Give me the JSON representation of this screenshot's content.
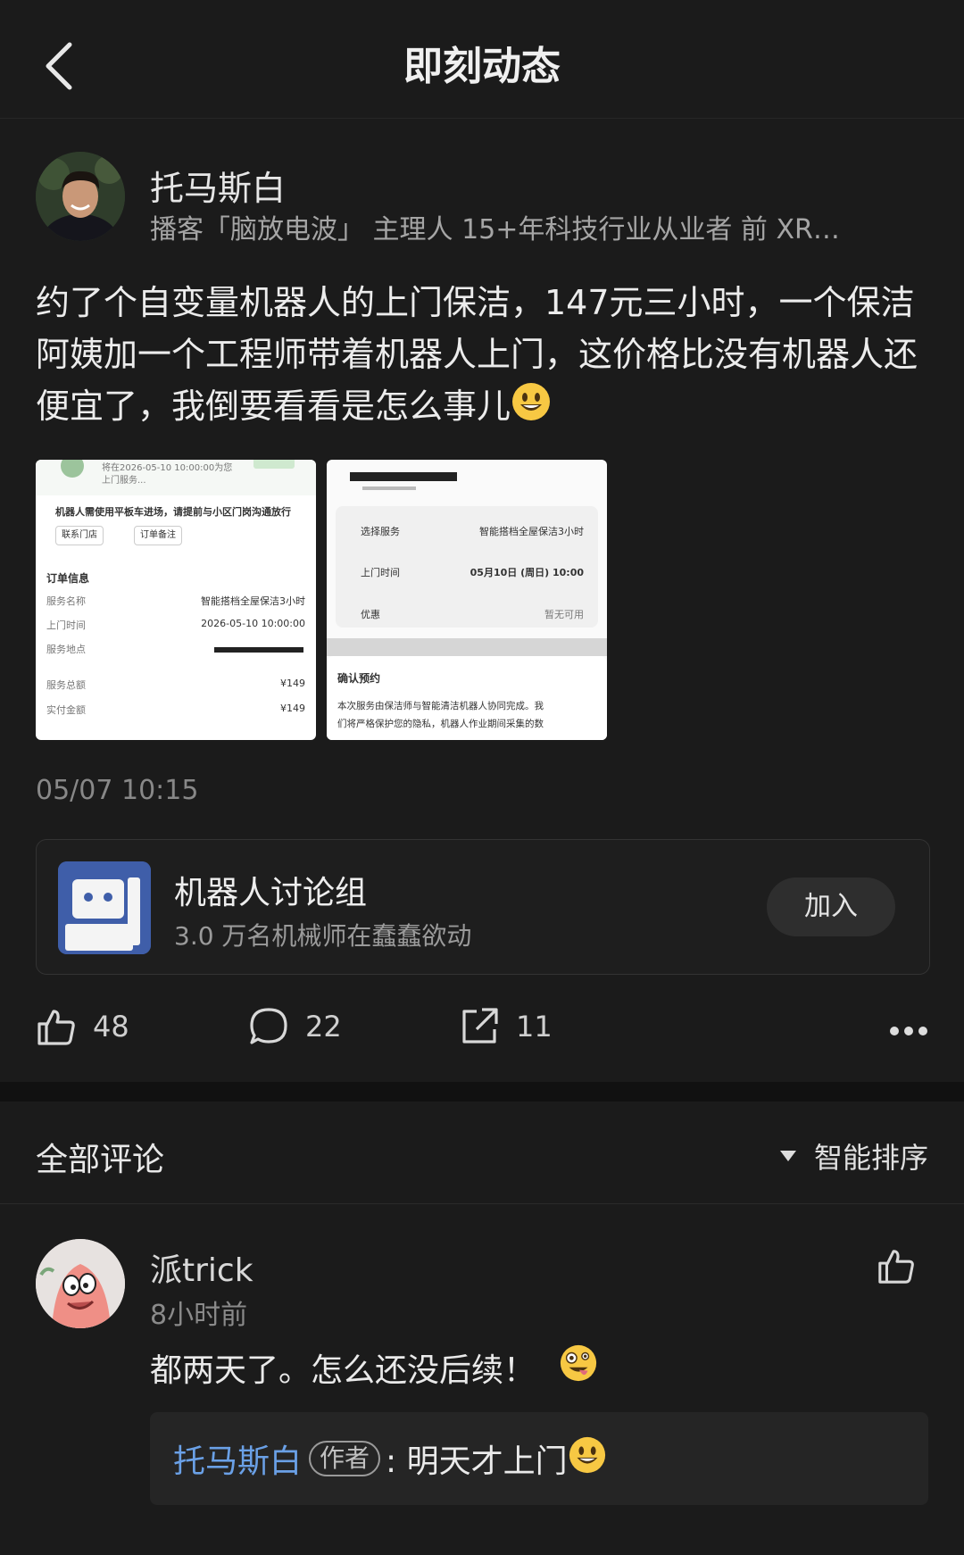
{
  "header": {
    "title": "即刻动态"
  },
  "post": {
    "author": "托马斯白",
    "author_desc": "播客「脑放电波」 主理人  15+年科技行业从业者  前 XR…",
    "text": "约了个自变量机器人的上门保洁，147元三小时，一个保洁阿姨加一个工程师带着机器人上门，这价格比没有机器人还便宜了，我倒要看看是怎么事儿",
    "timestamp": "05/07 10:15",
    "image1": {
      "top_line": "将在2026-05-10 10:00:00为您",
      "top_line2": "上门服务...",
      "notice": "机器人需使用平板车进场，请提前与小区门岗沟通放行",
      "btn_contact": "联系门店",
      "btn_note": "订单备注",
      "section": "订单信息",
      "rows": [
        {
          "k": "服务名称",
          "v": "智能搭档全屋保洁3小时"
        },
        {
          "k": "上门时间",
          "v": "2026-05-10 10:00:00"
        },
        {
          "k": "服务地点",
          "v": ""
        },
        {
          "k": "服务总额",
          "v": "¥149"
        },
        {
          "k": "实付金额",
          "v": "¥149"
        }
      ]
    },
    "image2": {
      "rows": [
        {
          "k": "选择服务",
          "v": "智能搭档全屋保洁3小时"
        },
        {
          "k": "上门时间",
          "v": "05月10日 (周日) 10:00"
        },
        {
          "k": "优惠",
          "v": "暂无可用"
        }
      ],
      "modal_title": "确认预约",
      "modal_text1": "本次服务由保洁师与智能清洁机器人协同完成。我",
      "modal_text2": "们将严格保护您的隐私，机器人作业期间采集的数"
    }
  },
  "group": {
    "name": "机器人讨论组",
    "subtitle": "3.0 万名机械师在蠢蠢欲动",
    "join_label": "加入"
  },
  "actions": {
    "likes": "48",
    "comments": "22",
    "shares": "11"
  },
  "comments_section": {
    "title": "全部评论",
    "sort_label": "智能排序"
  },
  "comment": {
    "name": "派trick",
    "time": "8小时前",
    "text": "都两天了。怎么还没后续！",
    "reply_author": "托马斯白",
    "reply_tag": "作者",
    "reply_text": ": 明天才上门"
  },
  "colors": {
    "background": "#1b1b1b",
    "accent_blue": "#6aa0e6",
    "group_icon": "#3d5fa8"
  },
  "icons": [
    "chevron-left-icon",
    "thumbs-up-icon",
    "comment-icon",
    "share-icon",
    "more-icon",
    "sort-caret-icon",
    "grinning-emoji",
    "zany-emoji"
  ]
}
